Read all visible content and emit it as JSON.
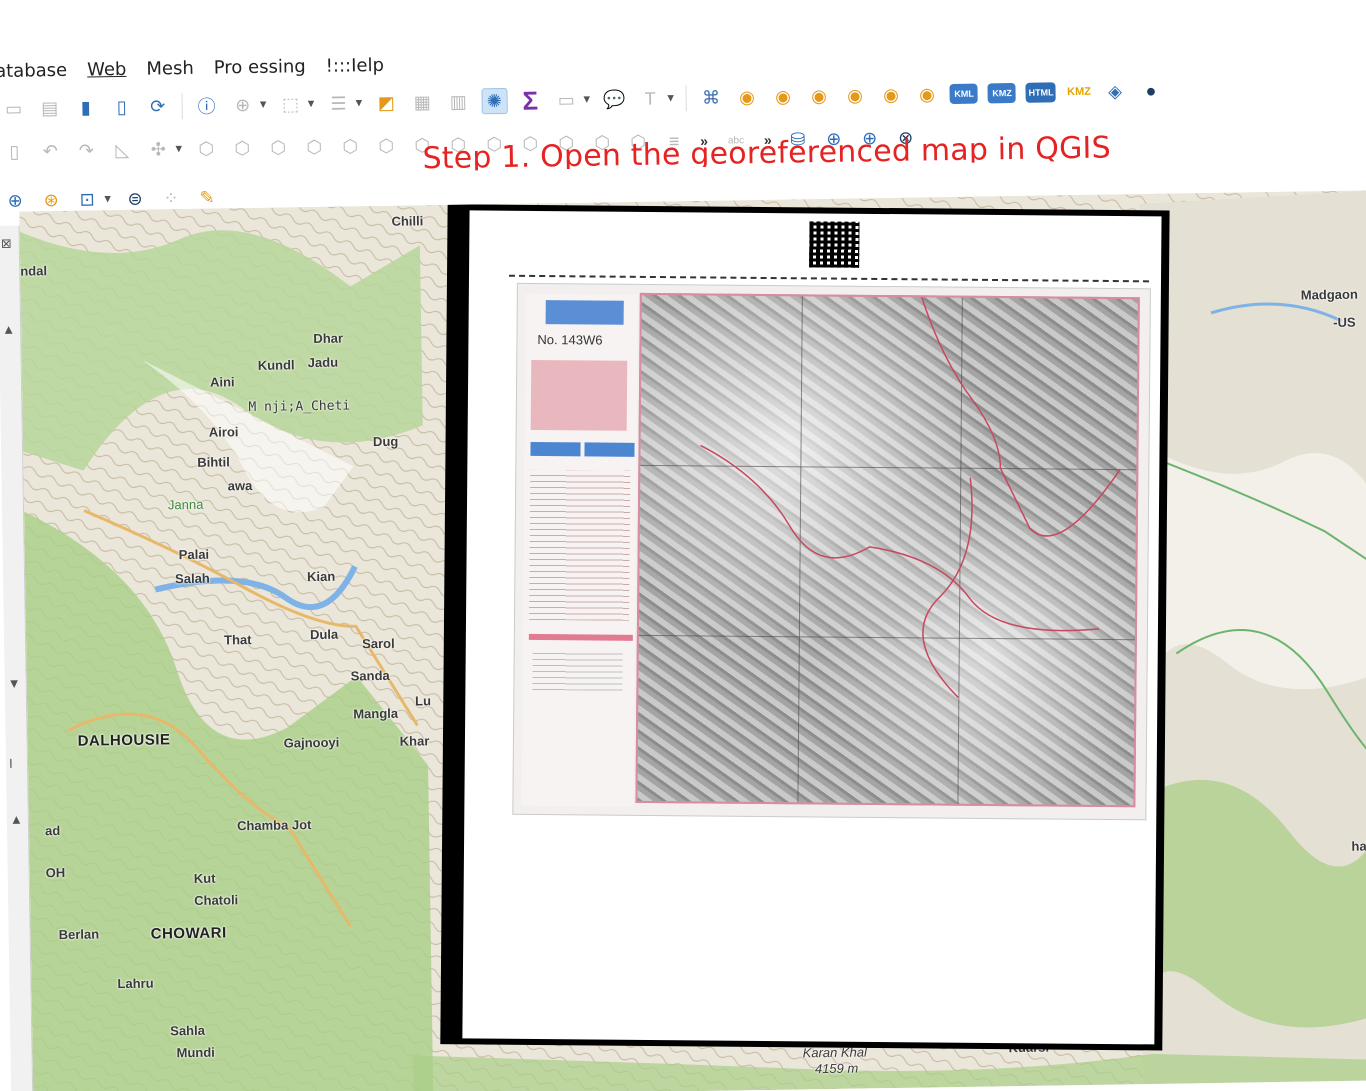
{
  "menu": {
    "items": [
      "atabase",
      "Web",
      "Mesh",
      "Pro essing",
      "!:::Ielp"
    ]
  },
  "annotation": {
    "text": "Step 1. Open the georeferenced map in  QGIS",
    "color": "#e52323"
  },
  "toolbar": {
    "kml_label": "KML",
    "kmz_label": "KMZ",
    "html_label": "HTML",
    "chevron": "»",
    "abc_label": "abc"
  },
  "map": {
    "places": {
      "chilli": "Chilli",
      "ndal": "ndal",
      "dhar": "Dhar",
      "kundl": "Kundl",
      "jadu": "Jadu",
      "aini": "Aini",
      "manji": "M nji;A_Cheti",
      "airoi": "Airoi",
      "dug": "Dug",
      "bihtil": "Bihtil",
      "awa": "awa",
      "janna": "Janna",
      "palai": "Palai",
      "salah": "Salah",
      "kian": "Kian",
      "that": "That",
      "dula": "Dula",
      "sarol": "Sarol",
      "sanda": "Sanda",
      "mangla": "Mangla",
      "lu": "Lu",
      "dalhousie": "DALHOUSIE",
      "gajnooyi": "Gajnooyi",
      "khar": "Khar",
      "chamba_jot": "Chamba Jot",
      "ad": "ad",
      "oh": "OH",
      "kut": "Kut",
      "chatoli": "Chatoli",
      "berlan": "Berlan",
      "chowari": "CHOWARI",
      "lahru": "Lahru",
      "sahla": "Sahla",
      "mundi": "Mundi",
      "karan_khal": "Karan Khal",
      "elev": "4159 m",
      "kuarsi": "Kuarsi",
      "madgaon": "Madgaon",
      "us": "-US",
      "hala": "hala"
    },
    "sheet": {
      "number": "No. 143W6"
    }
  }
}
